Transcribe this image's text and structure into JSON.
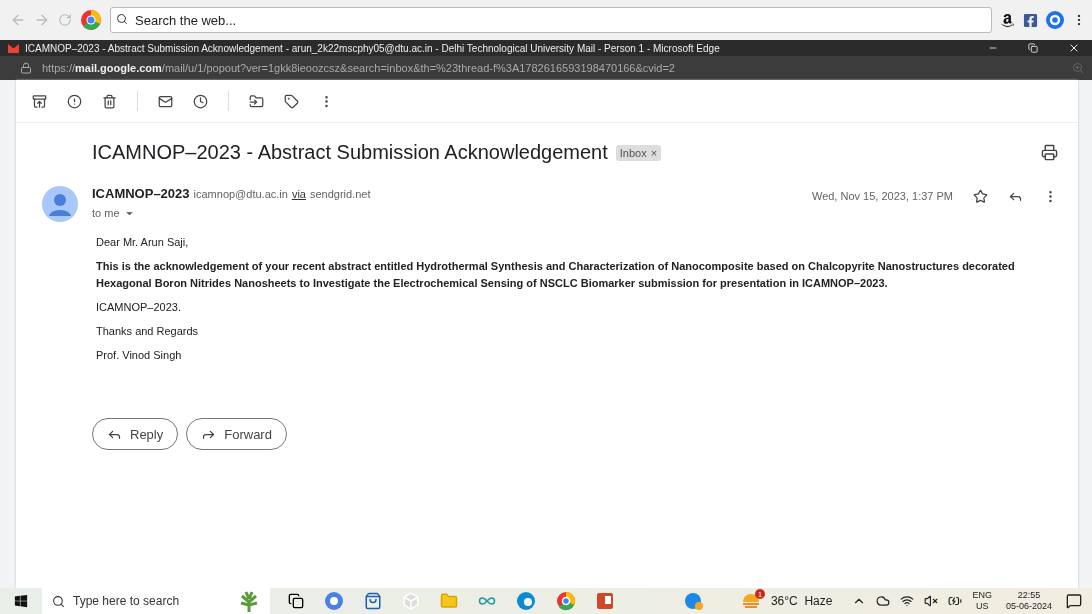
{
  "browser_toolbar": {
    "search": {
      "placeholder": "Search the web..."
    }
  },
  "window": {
    "title": "ICAMNOP–2023 - Abstract Submission Acknowledgement - arun_2k22mscphy05@dtu.ac.in - Delhi Technological University Mail - Person 1 - Microsoft Edge",
    "url": "https://**mail.google.com**/mail/u/1/popout?ver=1gkk8ieoozcsz&search=inbox&th=%23thread-f%3A1782616593198470166&cvid=2"
  },
  "message": {
    "subject": "ICAMNOP–2023 - Abstract Submission Acknowledgement",
    "label": {
      "text": "Inbox",
      "remove": "×"
    },
    "sender": {
      "name": "ICAMNOP–2023",
      "email": "icamnop@dtu.ac.in",
      "via": "via",
      "relay": "sendgrid.net",
      "recipient": "to me"
    },
    "date": "Wed, Nov 15, 2023, 1:37 PM",
    "starred": false,
    "body": [
      {
        "kind": "plain",
        "text": "Dear Mr. Arun Saji,"
      },
      {
        "kind": "bold",
        "text": "This is the acknowledgement of your recent abstract entitled Hydrothermal Synthesis and Characterization of Nanocomposite based on Chalcopyrite Nanostructures decorated Hexagonal Boron Nitrides Nanosheets to Investigate the Electrochemical Sensing of NSCLC Biomarker submission for presentation in ICAMNOP–2023."
      },
      {
        "kind": "plain",
        "text": "ICAMNOP–2023."
      },
      {
        "kind": "plain",
        "text": "Thanks and Regards"
      },
      {
        "kind": "plain",
        "text": "Prof. Vinod Singh"
      }
    ],
    "actions": [
      {
        "kind": "reply",
        "label": "Reply"
      },
      {
        "kind": "forward",
        "label": "Forward"
      }
    ]
  },
  "taskbar": {
    "search": {
      "placeholder": "Type here to search"
    },
    "weather": {
      "badge": "1",
      "text": "36°C  Haze"
    },
    "language": {
      "line1": "ENG",
      "line2": "US"
    },
    "clock": {
      "time": "22:55",
      "date": "05-06-2024"
    }
  }
}
